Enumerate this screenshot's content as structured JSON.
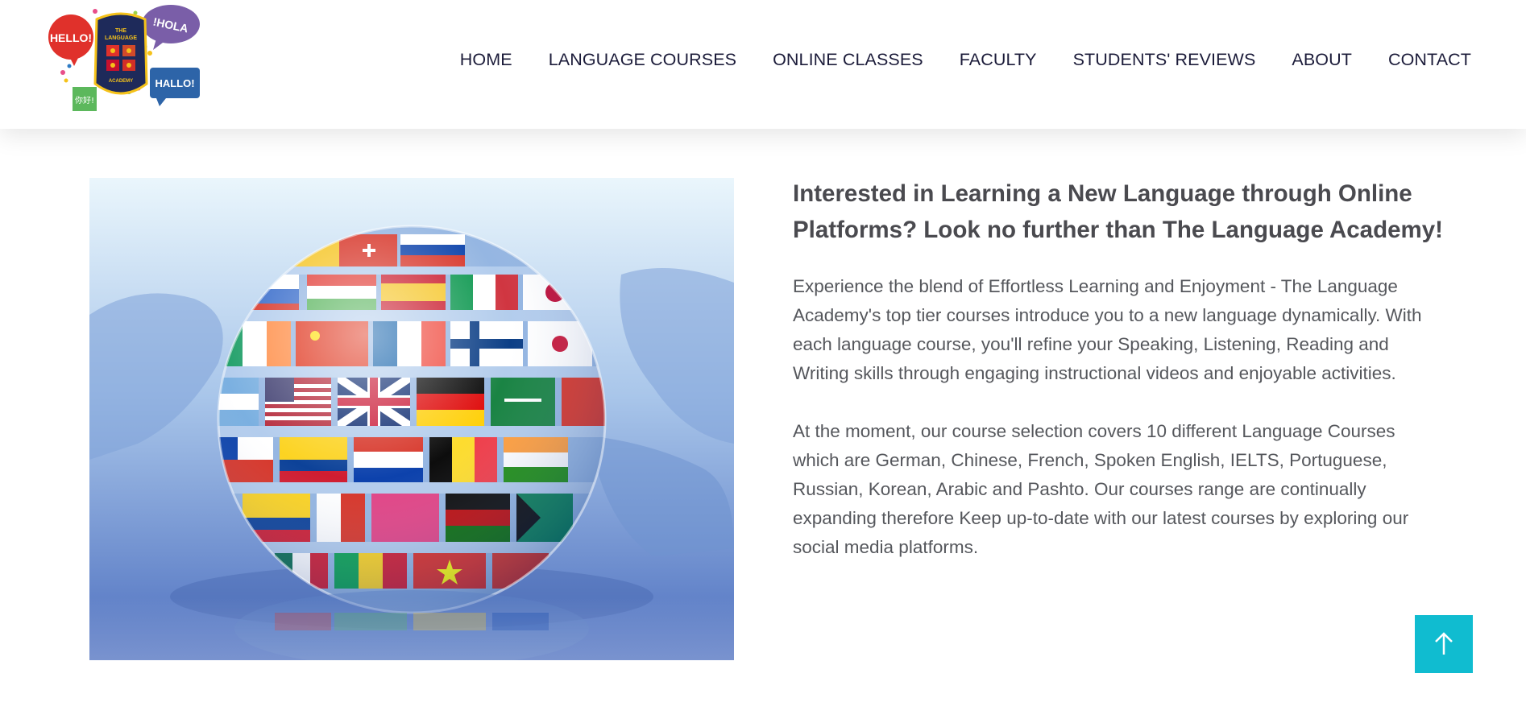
{
  "logo": {
    "alt": "The Language Academy",
    "bubbles": {
      "hello": "HELLO!",
      "hola": "!HOLA",
      "hallo": "HALLO!",
      "nihao": "你好!"
    },
    "badge_lines": [
      "THE",
      "LANGUAGE",
      "ACADEMY"
    ]
  },
  "nav": {
    "items": [
      {
        "label": "HOME"
      },
      {
        "label": "LANGUAGE COURSES"
      },
      {
        "label": "ONLINE CLASSES"
      },
      {
        "label": "FACULTY"
      },
      {
        "label": "STUDENTS' REVIEWS"
      },
      {
        "label": "ABOUT"
      },
      {
        "label": "CONTACT"
      }
    ]
  },
  "hero_image": {
    "alt": "Crystal globe covered in world flags over a world map"
  },
  "main": {
    "heading": "Interested in Learning a New Language through Online Platforms? Look no further than The Language Academy!",
    "paragraph1": "Experience the blend of Effortless Learning and Enjoyment - The Language Academy's top tier courses introduce you to a new language dynamically. With each language course, you'll refine your Speaking, Listening, Reading and Writing skills through engaging instructional videos and enjoyable activities.",
    "paragraph2": "At the moment, our course selection covers 10 different Language Courses which are German, Chinese, French, Spoken English, IELTS, Portuguese, Russian, Korean, Arabic and Pashto. Our courses range are continually expanding therefore Keep up-to-date with our latest courses by exploring our social media platforms."
  },
  "back_to_top": {
    "icon": "arrow-up-icon",
    "color": "#10bcd0"
  },
  "colors": {
    "nav_text": "#1c1c3a",
    "heading": "#4a4a4f",
    "body_text": "#55575c",
    "accent": "#10bcd0"
  }
}
